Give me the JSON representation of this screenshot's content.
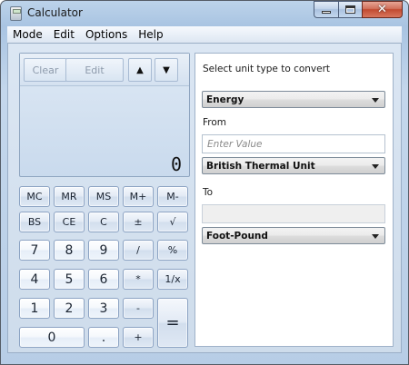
{
  "window": {
    "title": "Calculator"
  },
  "menu": [
    "Mode",
    "Edit",
    "Options",
    "Help"
  ],
  "display": {
    "clear_label": "Clear",
    "edit_label": "Edit",
    "up_label": "▲",
    "down_label": "▼",
    "value": "0"
  },
  "keys": {
    "mc": "MC",
    "mr": "MR",
    "ms": "MS",
    "mplus": "M+",
    "mminus": "M-",
    "bs": "BS",
    "ce": "CE",
    "c": "C",
    "plusminus": "±",
    "sqrt": "√",
    "k7": "7",
    "k8": "8",
    "k9": "9",
    "div": "/",
    "pct": "%",
    "k4": "4",
    "k5": "5",
    "k6": "6",
    "mul": "*",
    "recip": "1/x",
    "k1": "1",
    "k2": "2",
    "k3": "3",
    "sub": "-",
    "eq": "=",
    "k0": "0",
    "dot": ".",
    "add": "+"
  },
  "converter": {
    "unit_type_label": "Select unit type to convert",
    "unit_type_value": "Energy",
    "from_label": "From",
    "from_placeholder": "Enter Value",
    "from_unit": "British Thermal Unit",
    "to_label": "To",
    "to_unit": "Foot-Pound"
  }
}
